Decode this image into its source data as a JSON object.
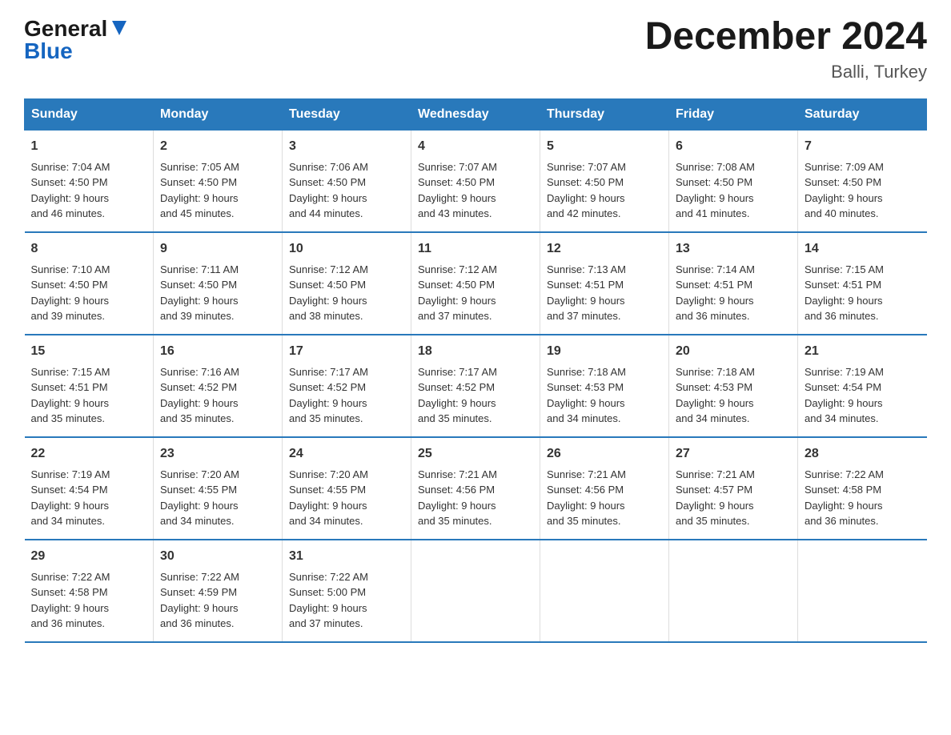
{
  "logo": {
    "general": "General",
    "blue": "Blue"
  },
  "title": "December 2024",
  "subtitle": "Balli, Turkey",
  "headers": [
    "Sunday",
    "Monday",
    "Tuesday",
    "Wednesday",
    "Thursday",
    "Friday",
    "Saturday"
  ],
  "weeks": [
    [
      {
        "day": "1",
        "sunrise": "7:04 AM",
        "sunset": "4:50 PM",
        "daylight": "9 hours and 46 minutes."
      },
      {
        "day": "2",
        "sunrise": "7:05 AM",
        "sunset": "4:50 PM",
        "daylight": "9 hours and 45 minutes."
      },
      {
        "day": "3",
        "sunrise": "7:06 AM",
        "sunset": "4:50 PM",
        "daylight": "9 hours and 44 minutes."
      },
      {
        "day": "4",
        "sunrise": "7:07 AM",
        "sunset": "4:50 PM",
        "daylight": "9 hours and 43 minutes."
      },
      {
        "day": "5",
        "sunrise": "7:07 AM",
        "sunset": "4:50 PM",
        "daylight": "9 hours and 42 minutes."
      },
      {
        "day": "6",
        "sunrise": "7:08 AM",
        "sunset": "4:50 PM",
        "daylight": "9 hours and 41 minutes."
      },
      {
        "day": "7",
        "sunrise": "7:09 AM",
        "sunset": "4:50 PM",
        "daylight": "9 hours and 40 minutes."
      }
    ],
    [
      {
        "day": "8",
        "sunrise": "7:10 AM",
        "sunset": "4:50 PM",
        "daylight": "9 hours and 39 minutes."
      },
      {
        "day": "9",
        "sunrise": "7:11 AM",
        "sunset": "4:50 PM",
        "daylight": "9 hours and 39 minutes."
      },
      {
        "day": "10",
        "sunrise": "7:12 AM",
        "sunset": "4:50 PM",
        "daylight": "9 hours and 38 minutes."
      },
      {
        "day": "11",
        "sunrise": "7:12 AM",
        "sunset": "4:50 PM",
        "daylight": "9 hours and 37 minutes."
      },
      {
        "day": "12",
        "sunrise": "7:13 AM",
        "sunset": "4:51 PM",
        "daylight": "9 hours and 37 minutes."
      },
      {
        "day": "13",
        "sunrise": "7:14 AM",
        "sunset": "4:51 PM",
        "daylight": "9 hours and 36 minutes."
      },
      {
        "day": "14",
        "sunrise": "7:15 AM",
        "sunset": "4:51 PM",
        "daylight": "9 hours and 36 minutes."
      }
    ],
    [
      {
        "day": "15",
        "sunrise": "7:15 AM",
        "sunset": "4:51 PM",
        "daylight": "9 hours and 35 minutes."
      },
      {
        "day": "16",
        "sunrise": "7:16 AM",
        "sunset": "4:52 PM",
        "daylight": "9 hours and 35 minutes."
      },
      {
        "day": "17",
        "sunrise": "7:17 AM",
        "sunset": "4:52 PM",
        "daylight": "9 hours and 35 minutes."
      },
      {
        "day": "18",
        "sunrise": "7:17 AM",
        "sunset": "4:52 PM",
        "daylight": "9 hours and 35 minutes."
      },
      {
        "day": "19",
        "sunrise": "7:18 AM",
        "sunset": "4:53 PM",
        "daylight": "9 hours and 34 minutes."
      },
      {
        "day": "20",
        "sunrise": "7:18 AM",
        "sunset": "4:53 PM",
        "daylight": "9 hours and 34 minutes."
      },
      {
        "day": "21",
        "sunrise": "7:19 AM",
        "sunset": "4:54 PM",
        "daylight": "9 hours and 34 minutes."
      }
    ],
    [
      {
        "day": "22",
        "sunrise": "7:19 AM",
        "sunset": "4:54 PM",
        "daylight": "9 hours and 34 minutes."
      },
      {
        "day": "23",
        "sunrise": "7:20 AM",
        "sunset": "4:55 PM",
        "daylight": "9 hours and 34 minutes."
      },
      {
        "day": "24",
        "sunrise": "7:20 AM",
        "sunset": "4:55 PM",
        "daylight": "9 hours and 34 minutes."
      },
      {
        "day": "25",
        "sunrise": "7:21 AM",
        "sunset": "4:56 PM",
        "daylight": "9 hours and 35 minutes."
      },
      {
        "day": "26",
        "sunrise": "7:21 AM",
        "sunset": "4:56 PM",
        "daylight": "9 hours and 35 minutes."
      },
      {
        "day": "27",
        "sunrise": "7:21 AM",
        "sunset": "4:57 PM",
        "daylight": "9 hours and 35 minutes."
      },
      {
        "day": "28",
        "sunrise": "7:22 AM",
        "sunset": "4:58 PM",
        "daylight": "9 hours and 36 minutes."
      }
    ],
    [
      {
        "day": "29",
        "sunrise": "7:22 AM",
        "sunset": "4:58 PM",
        "daylight": "9 hours and 36 minutes."
      },
      {
        "day": "30",
        "sunrise": "7:22 AM",
        "sunset": "4:59 PM",
        "daylight": "9 hours and 36 minutes."
      },
      {
        "day": "31",
        "sunrise": "7:22 AM",
        "sunset": "5:00 PM",
        "daylight": "9 hours and 37 minutes."
      },
      null,
      null,
      null,
      null
    ]
  ],
  "labels": {
    "sunrise": "Sunrise:",
    "sunset": "Sunset:",
    "daylight": "Daylight:"
  }
}
